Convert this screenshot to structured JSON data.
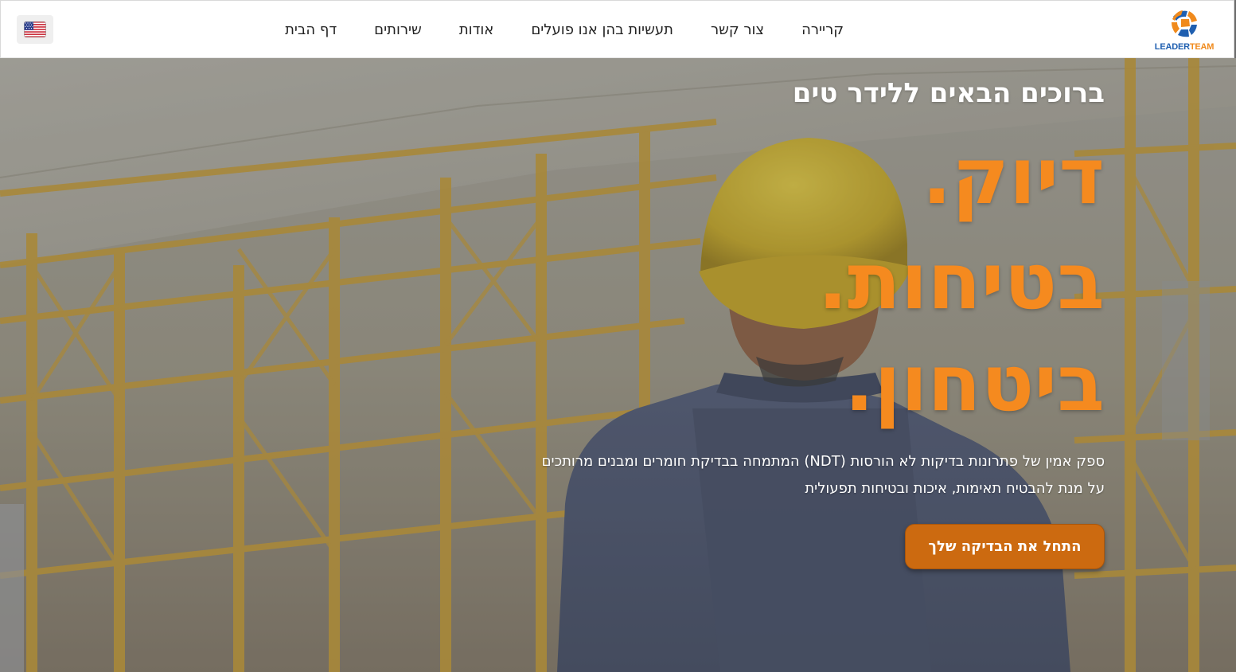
{
  "header": {
    "language_flag": "us-flag-icon",
    "nav": [
      {
        "label": "דף הבית"
      },
      {
        "label": "שירותים"
      },
      {
        "label": "אודות"
      },
      {
        "label": "תעשיות בהן אנו פועלים"
      },
      {
        "label": "צור קשר"
      },
      {
        "label": "קריירה"
      }
    ],
    "logo": {
      "text_part1": "LEADER",
      "text_part2": "TEAM"
    }
  },
  "hero": {
    "welcome": "ברוכים הבאים ללידר טים",
    "headline": [
      "דיוק.",
      "בטיחות.",
      "ביטחון."
    ],
    "description_line1": "ספק אמין של פתרונות בדיקות לא הורסות (NDT) המתמחה בבדיקת חומרים ומבנים מרותכים",
    "description_line2": "על מנת להבטיח תאימות, איכות ובטיחות תפעולית",
    "cta_label": "התחל את הבדיקה שלך"
  },
  "colors": {
    "accent": "#f58a1f",
    "cta_bg": "#cc6a10",
    "logo_blue": "#1f5fb0",
    "logo_orange": "#f08a1c"
  }
}
